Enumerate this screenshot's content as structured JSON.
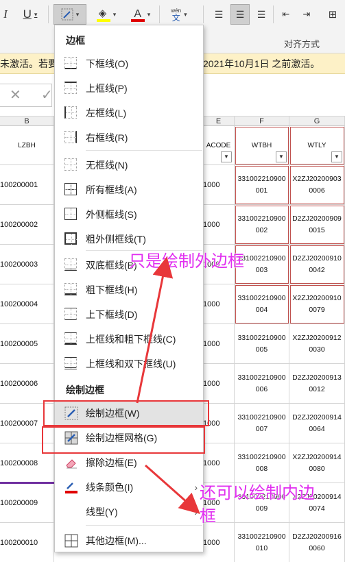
{
  "ribbon": {
    "italic_label": "I",
    "underline_label": "U",
    "font_color_label": "A",
    "phonetic_top": "wén",
    "phonetic_bottom": "文",
    "alignment_group_label": "对齐方式",
    "colors": {
      "fill_bar": "#ffff00",
      "font_bar": "#e00000"
    }
  },
  "warning": {
    "text_left": "未激活。若要",
    "text_right": "2021年10月1日 之前激活。"
  },
  "formula_bar": {
    "cancel": "✕",
    "confirm": "✓"
  },
  "columns": {
    "B": "B",
    "E": "E",
    "F": "F",
    "G": "G"
  },
  "table": {
    "headers": {
      "B": "LZBH",
      "E": "ACODE",
      "F": "WTBH",
      "G": "WTLY"
    },
    "rows": [
      {
        "B": "100200001",
        "E": "1000",
        "F": "331002210900\n001",
        "G": "X2ZJ20200903\n0006"
      },
      {
        "B": "100200002",
        "E": "1000",
        "F": "331002210900\n002",
        "G": "D2ZJ20200909\n0015"
      },
      {
        "B": "100200003",
        "E": "1000",
        "F": "331002210900\n003",
        "G": "D2ZJ20200910\n0042"
      },
      {
        "B": "100200004",
        "E": "1000",
        "F": "331002210900\n004",
        "G": "X2ZJ20200910\n0079"
      },
      {
        "B": "100200005",
        "E": "1000",
        "F": "331002210900\n005",
        "G": "X2ZJ20200912\n0030"
      },
      {
        "B": "100200006",
        "E": "1000",
        "F": "331002210900\n006",
        "G": "D2ZJ20200913\n0012"
      },
      {
        "B": "100200007",
        "E": "1000",
        "F": "331002210900\n007",
        "G": "D2ZJ20200914\n0064"
      },
      {
        "B": "100200008",
        "E": "1000",
        "F": "331002210900\n008",
        "G": "X2ZJ20200914\n0080"
      },
      {
        "B": "100200009",
        "E": "1000",
        "F": "331002210900\n009",
        "G": "X2ZJ20200914\n0074"
      },
      {
        "B": "100200010",
        "E": "1000",
        "F": "331002210900\n010",
        "G": "D2ZJ20200916\n0060"
      }
    ]
  },
  "menu": {
    "section_borders": "边框",
    "section_draw": "绘制边框",
    "items": [
      {
        "label": "下框线(O)"
      },
      {
        "label": "上框线(P)"
      },
      {
        "label": "左框线(L)"
      },
      {
        "label": "右框线(R)"
      },
      {
        "label": "无框线(N)"
      },
      {
        "label": "所有框线(A)"
      },
      {
        "label": "外侧框线(S)"
      },
      {
        "label": "粗外侧框线(T)"
      },
      {
        "label": "双底框线(B)"
      },
      {
        "label": "粗下框线(H)"
      },
      {
        "label": "上下框线(D)"
      },
      {
        "label": "上框线和粗下框线(C)"
      },
      {
        "label": "上框线和双下框线(U)"
      }
    ],
    "draw_items": [
      {
        "label": "绘制边框(W)"
      },
      {
        "label": "绘制边框网格(G)"
      },
      {
        "label": "擦除边框(E)"
      },
      {
        "label": "线条颜色(I)"
      },
      {
        "label": "线型(Y)"
      },
      {
        "label": "其他边框(M)..."
      }
    ],
    "line_color_swatch": "#e00000"
  },
  "annotations": {
    "outer_only": "只是绘制外边框",
    "inner_line1": "还可以绘制内边",
    "inner_line2": "框",
    "color": "#e12ef0",
    "box_color": "#e8373a"
  }
}
